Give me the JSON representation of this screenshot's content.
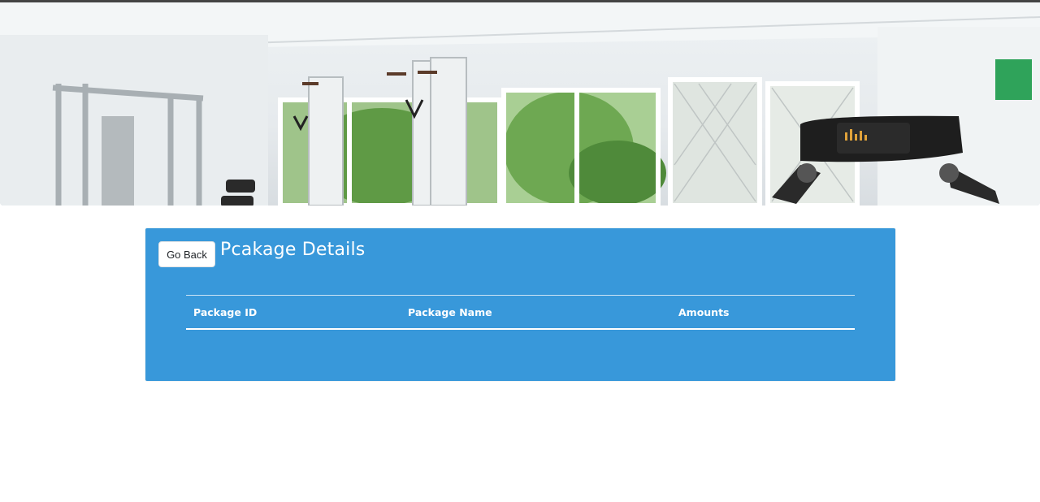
{
  "hero": {
    "image_icon": "gym-interior-photo"
  },
  "panel": {
    "back_button_label": "Go Back",
    "title": "Pcakage Details",
    "background_color": "#3898da",
    "table": {
      "columns": [
        "Package ID",
        "Package Name",
        "Amounts"
      ],
      "rows": []
    }
  }
}
